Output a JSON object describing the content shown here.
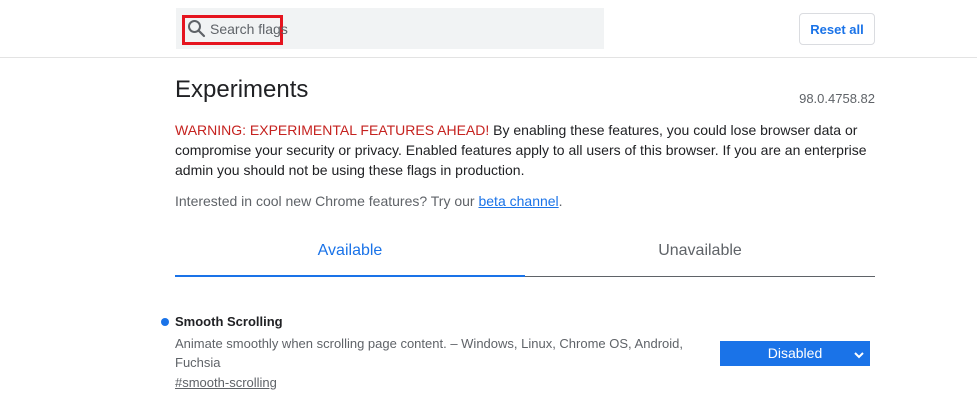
{
  "header": {
    "search": {
      "placeholder": "Search flags",
      "value": ""
    },
    "reset_label": "Reset all"
  },
  "main": {
    "title": "Experiments",
    "version": "98.0.4758.82",
    "warning": {
      "label": "WARNING: EXPERIMENTAL FEATURES AHEAD!",
      "body": " By enabling these features, you could lose browser data or compromise your security or privacy. Enabled features apply to all users of this browser. If you are an enterprise admin you should not be using these flags in production."
    },
    "interest": {
      "text": "Interested in cool new Chrome features? Try our ",
      "link": "beta channel",
      "end": "."
    },
    "tabs": [
      {
        "label": "Available",
        "selected": true
      },
      {
        "label": "Unavailable",
        "selected": false
      }
    ],
    "flags": [
      {
        "name": "Smooth Scrolling",
        "description": "Animate smoothly when scrolling page content. – Windows, Linux, Chrome OS, Android, Fuchsia",
        "link": "#smooth-scrolling",
        "selected_option": "Disabled"
      }
    ]
  },
  "colors": {
    "accent": "#1a73e8",
    "warning": "#c5221f",
    "highlight": "#e5141f",
    "search_bg": "#f1f3f4"
  },
  "icons": {
    "search": "search-icon",
    "dropdown": "chevron-down-icon",
    "modified_indicator": "dot-icon"
  }
}
